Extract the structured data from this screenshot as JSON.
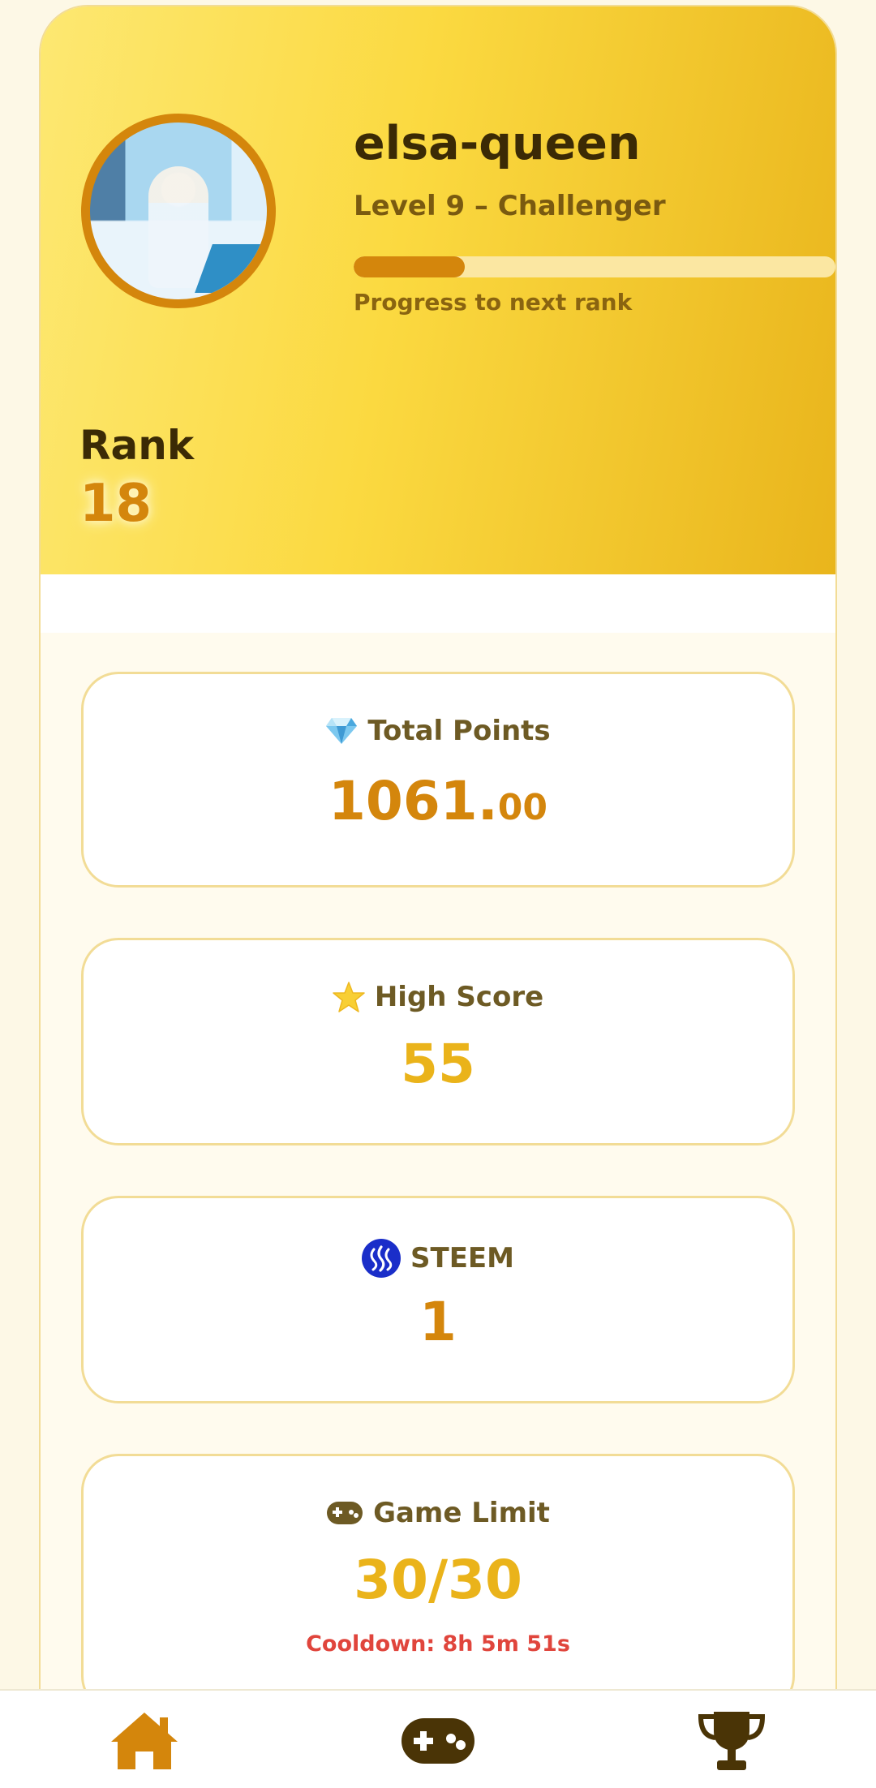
{
  "profile": {
    "username": "elsa-queen",
    "level": "Level 9 – Challenger",
    "progress": 0.23,
    "progress_label": "Progress to next rank",
    "rank_label": "Rank",
    "rank_value": "18"
  },
  "stats": {
    "total_points": {
      "icon": "gem-icon",
      "label": "Total Points",
      "value_int": "1061.",
      "value_dec": "00"
    },
    "high_score": {
      "icon": "star-icon",
      "label": "High Score",
      "value": "55"
    },
    "steem": {
      "icon": "steem-logo-icon",
      "label": "STEEM",
      "value": "1"
    },
    "game_limit": {
      "icon": "gamepad-icon",
      "label": "Game Limit",
      "value": "30/30",
      "cooldown": "Cooldown: 8h 5m 51s"
    }
  },
  "nav": [
    {
      "icon": "home-icon",
      "active": true
    },
    {
      "icon": "gamepad-icon"
    },
    {
      "icon": "trophy-icon"
    }
  ],
  "colors": {
    "accent": "#d4860c",
    "gold": "#eab31a",
    "text_dark": "#3b2a05",
    "alert": "#e0453c",
    "steem_blue": "#1a2ec9"
  }
}
